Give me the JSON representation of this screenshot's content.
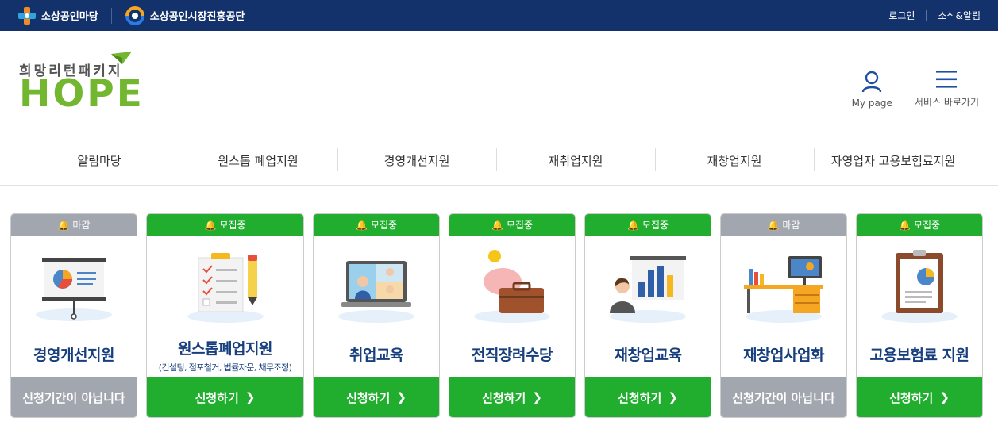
{
  "topbar": {
    "brand1": "소상공인마당",
    "brand2": "소상공인시장진흥공단",
    "login": "로그인",
    "news": "소식&알림"
  },
  "logo": {
    "subtitle": "희망리턴패키지",
    "wordmark": "HOPE"
  },
  "header_tools": {
    "mypage": "My page",
    "shortcuts": "서비스 바로가기"
  },
  "nav": [
    "알림마당",
    "원스톱 폐업지원",
    "경영개선지원",
    "재취업지원",
    "재창업지원",
    "자영업자 고용보험료지원"
  ],
  "colors": {
    "topbar": "#13326b",
    "open": "#21ae2f",
    "closed": "#a2a6ae",
    "title": "#173f7d",
    "logo": "#72b72f"
  },
  "cards": [
    {
      "status": "마감",
      "title": "경영개선지원",
      "subtitle": "",
      "action": "신청기간이 아닙니다",
      "icon": "presentation-chart-icon"
    },
    {
      "status": "모집중",
      "title": "원스톱폐업지원",
      "subtitle": "(컨설팅, 점포철거, 법률자문, 채무조정)",
      "action": "신청하기",
      "icon": "checklist-clipboard-icon"
    },
    {
      "status": "모집중",
      "title": "취업교육",
      "subtitle": "",
      "action": "신청하기",
      "icon": "video-lecture-icon"
    },
    {
      "status": "모집중",
      "title": "전직장려수당",
      "subtitle": "",
      "action": "신청하기",
      "icon": "piggybank-briefcase-icon"
    },
    {
      "status": "모집중",
      "title": "재창업교육",
      "subtitle": "",
      "action": "신청하기",
      "icon": "presenter-chart-icon"
    },
    {
      "status": "마감",
      "title": "재창업사업화",
      "subtitle": "",
      "action": "신청기간이 아닙니다",
      "icon": "office-desk-icon"
    },
    {
      "status": "모집중",
      "title": "고용보험료 지원",
      "subtitle": "",
      "action": "신청하기",
      "icon": "report-board-icon"
    }
  ]
}
